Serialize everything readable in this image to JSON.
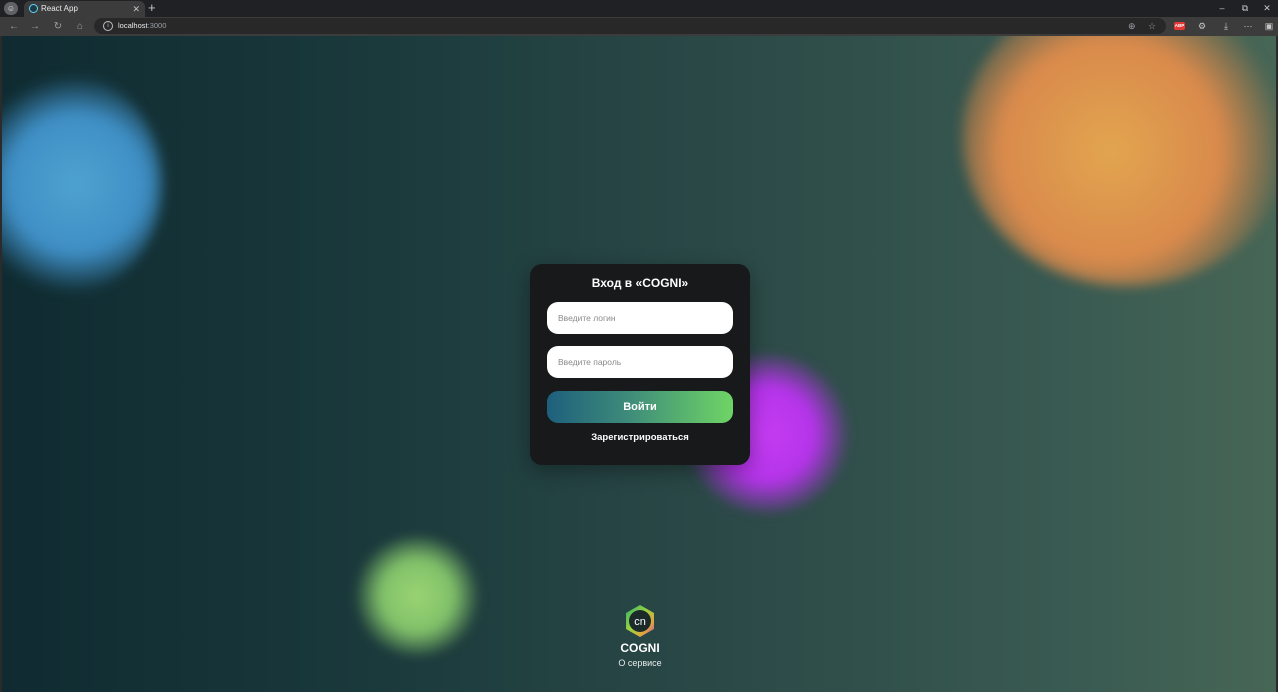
{
  "browser": {
    "profile_glyph": "☺",
    "tab": {
      "title": "React App",
      "close_glyph": "✕"
    },
    "new_tab_glyph": "+",
    "window_controls": {
      "minimize": "–",
      "restore": "⧉",
      "close": "✕"
    },
    "nav": {
      "back": "←",
      "forward": "→",
      "reload": "↻",
      "home": "⌂"
    },
    "url": {
      "host": "localhost",
      "port": ":3000"
    },
    "extension_badge": "ABP",
    "icons": [
      "zoom-icon",
      "star-icon",
      "extension-icon",
      "settings-icon",
      "download-icon",
      "menu-icon",
      "sidebar-icon"
    ]
  },
  "login": {
    "title": "Вход в «COGNI»",
    "login_placeholder": "Введите логин",
    "password_placeholder": "Введите пароль",
    "submit_label": "Войти",
    "register_label": "Зарегистрироваться"
  },
  "footer": {
    "logo_text": "cn",
    "brand_name": "COGNI",
    "about_label": "О сервисе"
  },
  "colors": {
    "card": "#17191b",
    "button_gradient_start": "#1e5f7c",
    "button_gradient_end": "#6fd565",
    "accent_purple": "#b534ea",
    "accent_orange": "#d98a4c",
    "accent_blue": "#3f8fc6",
    "accent_green": "#82c26a"
  }
}
